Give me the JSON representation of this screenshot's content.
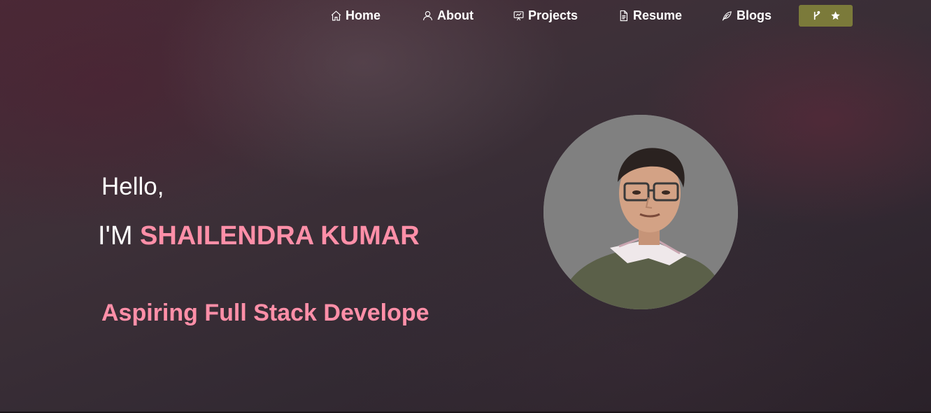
{
  "nav": {
    "items": [
      {
        "label": "Home",
        "icon": "home-icon"
      },
      {
        "label": "About",
        "icon": "user-icon"
      },
      {
        "label": "Projects",
        "icon": "presentation-icon"
      },
      {
        "label": "Resume",
        "icon": "document-icon"
      },
      {
        "label": "Blogs",
        "icon": "feather-icon"
      }
    ],
    "github_button": {
      "icons": [
        "git-fork-icon",
        "star-icon"
      ],
      "color": "#7b7a3a"
    }
  },
  "hero": {
    "greeting": "Hello,",
    "intro_prefix": "I'M ",
    "name": "SHAILENDRA KUMAR",
    "tagline": "Aspiring Full Stack Develope"
  },
  "colors": {
    "accent": "#ff8fa8",
    "text": "#ffffff",
    "avatar_bg": "#808080"
  }
}
